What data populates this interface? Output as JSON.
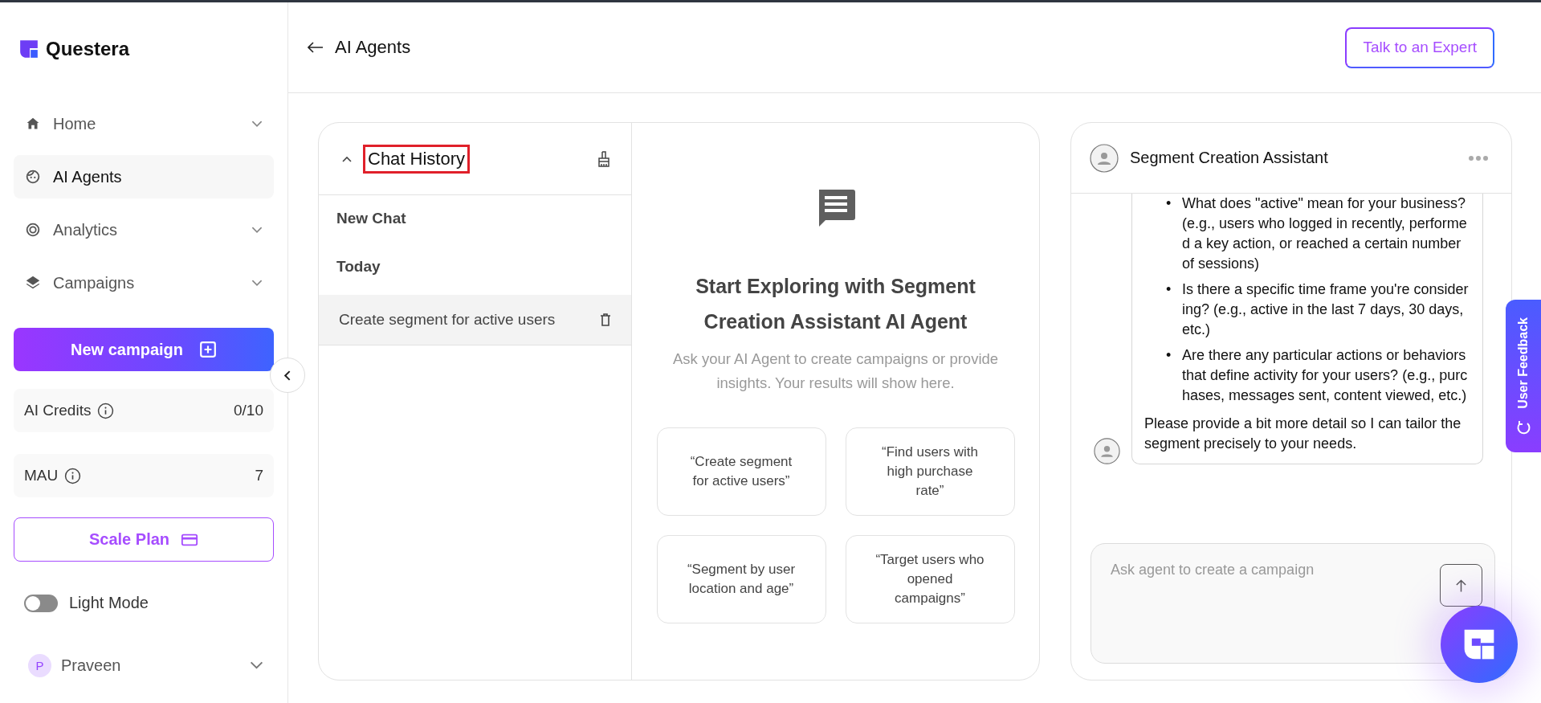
{
  "brand": {
    "name": "Questera"
  },
  "sidebar": {
    "items": [
      {
        "label": "Home",
        "expandable": true,
        "selected": false
      },
      {
        "label": "AI Agents",
        "expandable": false,
        "selected": true
      },
      {
        "label": "Analytics",
        "expandable": true,
        "selected": false
      },
      {
        "label": "Campaigns",
        "expandable": true,
        "selected": false
      }
    ],
    "new_campaign": "New campaign",
    "stats": [
      {
        "label": "AI Credits",
        "value": "0/10"
      },
      {
        "label": "MAU",
        "value": "7"
      }
    ],
    "scale_plan": "Scale Plan",
    "theme_toggle": {
      "label": "Light Mode",
      "on": false
    },
    "user": {
      "initial": "P",
      "name": "Praveen"
    }
  },
  "header": {
    "title": "AI Agents",
    "action": "Talk to an Expert"
  },
  "chat_history": {
    "title": "Chat History",
    "highlighted": true,
    "new_chat": "New Chat",
    "groups": [
      {
        "label": "Today",
        "chats": [
          {
            "title": "Create segment for active users",
            "selected": true
          }
        ]
      }
    ]
  },
  "welcome": {
    "heading": "Start Exploring with Segment Creation Assistant AI Agent",
    "subtitle": "Ask your AI Agent to create campaigns or provide insights. Your results will show here.",
    "suggestions": [
      "“Create segment for active users”",
      "“Find users with high purchase rate”",
      "“Segment by user location and age”",
      "“Target users who opened campaigns”"
    ]
  },
  "assistant": {
    "title": "Segment Creation Assistant",
    "message": {
      "marker": "•",
      "bullets": [
        "What does \"active\" mean for your business? (e.g., users who logged in recently, performed a key action, or reached a certain number of sessions)",
        "Is there a specific time frame you're considering? (e.g., active in the last 7 days, 30 days, etc.)",
        "Are there any particular actions or behaviors that define activity for your users? (e.g., purchases, messages sent, content viewed, etc.)"
      ],
      "closing": "Please provide a bit more detail so I can tailor the segment precisely to your needs."
    },
    "input": {
      "placeholder": "Ask agent to create a campaign"
    }
  },
  "feedback_tab": "User Feedback"
}
